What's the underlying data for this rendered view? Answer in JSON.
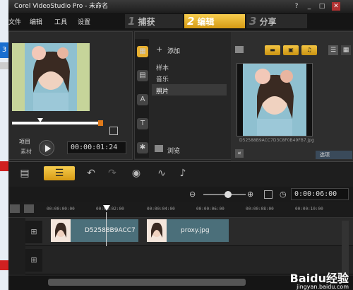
{
  "window": {
    "title": "Corel VideoStudio Pro - 未命名"
  },
  "menu": [
    "文件",
    "编辑",
    "工具",
    "设置"
  ],
  "steps": [
    {
      "num": "1",
      "label": "捕获"
    },
    {
      "num": "2",
      "label": "编辑"
    },
    {
      "num": "3",
      "label": "分享"
    }
  ],
  "preview": {
    "project_label": "项目",
    "clip_label": "素材",
    "timecode": "00:00:01:24"
  },
  "library": {
    "add_label": "添加",
    "items": [
      "样本",
      "音乐",
      "照片"
    ],
    "selected_item": "照片",
    "browse_label": "浏览",
    "thumb_caption": "D52588B9ACC7D3C8F0B49FB7.jpg",
    "options_label": "选项"
  },
  "timeline": {
    "zoom_timecode": "0:00:06:00",
    "ruler_ticks": [
      "00:00:00:00",
      "00:00:02:00",
      "00:00:04:00",
      "00:00:06:00",
      "00:00:08:00",
      "00:00:10:00"
    ],
    "clips": [
      {
        "name": "D52588B9ACC7"
      },
      {
        "name": "proxy.jpg"
      }
    ]
  },
  "watermark": {
    "brand": "Baidu经验",
    "url": "jingyan.baidu.com"
  },
  "colors": {
    "accent": "#f0b428",
    "orange": "#e07a1a",
    "clip": "#4b6f7a"
  }
}
